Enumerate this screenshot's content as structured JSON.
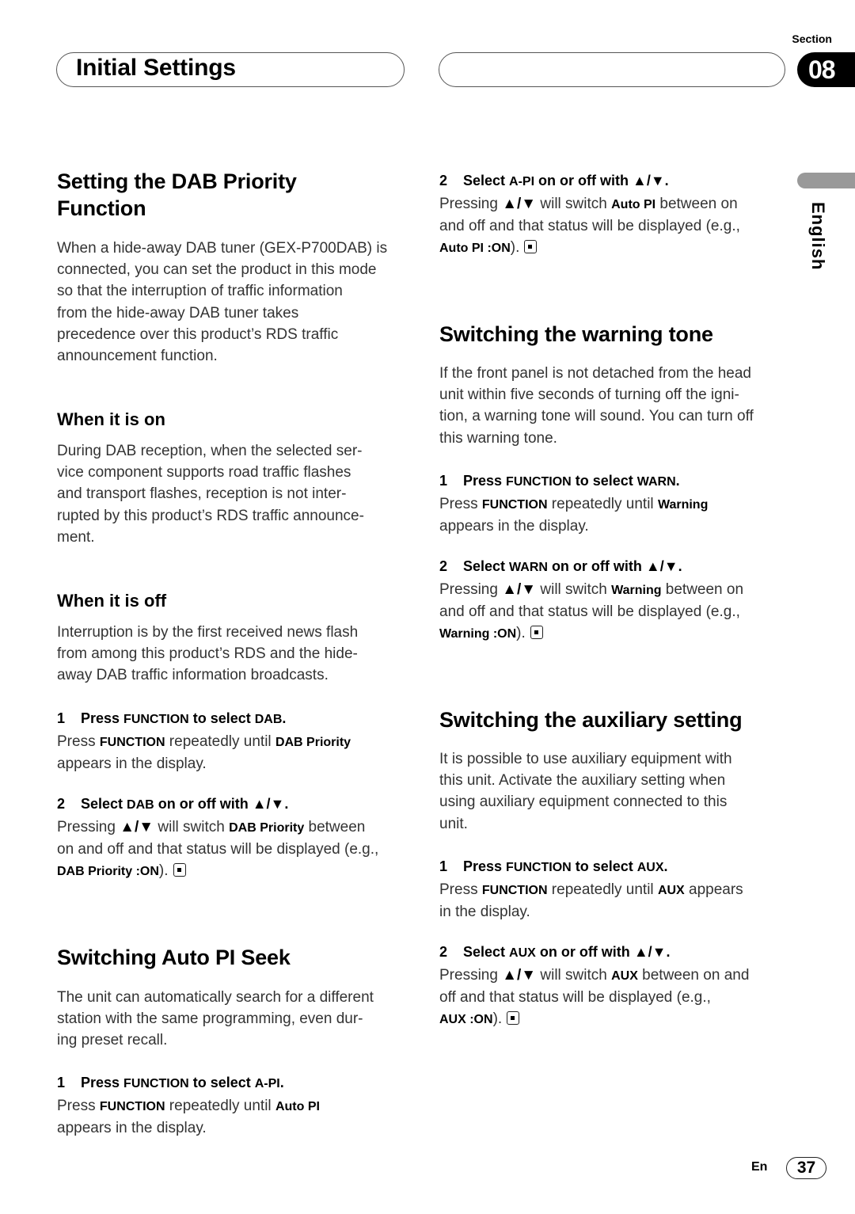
{
  "header": {
    "title": "Initial Settings",
    "section_label": "Section",
    "section_number": "08"
  },
  "sidebar": {
    "language": "English"
  },
  "icons": {
    "up_down": "▲/▼",
    "end_mark": "end-of-section-icon"
  },
  "left": {
    "dab": {
      "title_line1": "Setting the DAB Priority",
      "title_line2": "Function",
      "intro": [
        "When a hide-away DAB tuner (GEX-P700DAB) is",
        "connected, you can set the product in this mode",
        "so that the interruption of traffic information",
        "from the hide-away DAB tuner takes",
        "precedence over this product’s RDS traffic",
        "announcement function."
      ],
      "on": {
        "title": "When it is on",
        "lines": [
          "During DAB reception, when the selected ser-",
          "vice component supports road traffic flashes",
          "and transport flashes, reception is not inter-",
          "rupted by this product’s RDS traffic announce-",
          "ment."
        ]
      },
      "off": {
        "title": "When it is off",
        "lines": [
          "Interruption is by the first received news flash",
          "from among this product’s RDS and the hide-",
          "away DAB traffic information broadcasts."
        ]
      },
      "step1": {
        "num": "1",
        "pre": "Press ",
        "key": "FUNCTION",
        "mid": " to select ",
        "target": "DAB",
        "end": ".",
        "body_pre": "Press ",
        "body_key": "FUNCTION",
        "body_mid": " repeatedly until ",
        "body_target": "DAB Priority",
        "body_line2": "appears in the display."
      },
      "step2": {
        "num": "2",
        "pre": "Select ",
        "target": "DAB",
        "mid": " on or off with ",
        "end": ".",
        "body_pre": "Pressing ",
        "body_mid": " will switch ",
        "body_target": "DAB Priority",
        "body_post": " between",
        "body_line2": "on and off and that status will be displayed (e.g.,",
        "body_example": "DAB Priority :ON",
        "body_close": ")."
      }
    },
    "api": {
      "title": "Switching Auto PI Seek",
      "intro": [
        "The unit can automatically search for a different",
        "station with the same programming, even dur-",
        "ing preset recall."
      ],
      "step1": {
        "num": "1",
        "pre": "Press ",
        "key": "FUNCTION",
        "mid": " to select ",
        "target": "A-PI",
        "end": ".",
        "body_pre": "Press ",
        "body_key": "FUNCTION",
        "body_mid": " repeatedly until ",
        "body_target": "Auto PI",
        "body_line2": "appears in the display."
      }
    }
  },
  "right": {
    "api_step2": {
      "num": "2",
      "pre": "Select ",
      "target": "A-PI",
      "mid": " on or off with ",
      "end": ".",
      "body_pre": "Pressing ",
      "body_mid": " will switch ",
      "body_target": "Auto PI",
      "body_post": " between on",
      "body_line2": "and off and that status will be displayed (e.g.,",
      "body_example": "Auto PI :ON",
      "body_close": ")."
    },
    "warn": {
      "title": "Switching the warning tone",
      "intro": [
        "If the front panel is not detached from the head",
        "unit within five seconds of turning off the igni-",
        "tion, a warning tone will sound. You can turn off",
        "this warning tone."
      ],
      "step1": {
        "num": "1",
        "pre": "Press ",
        "key": "FUNCTION",
        "mid": " to select ",
        "target": "WARN",
        "end": ".",
        "body_pre": "Press ",
        "body_key": "FUNCTION",
        "body_mid": " repeatedly until ",
        "body_target": "Warning",
        "body_line2": "appears in the display."
      },
      "step2": {
        "num": "2",
        "pre": "Select ",
        "target": "WARN",
        "mid": " on or off with ",
        "end": ".",
        "body_pre": "Pressing ",
        "body_mid": " will switch ",
        "body_target": "Warning",
        "body_post": " between on",
        "body_line2": "and off and that status will be displayed (e.g.,",
        "body_example": "Warning :ON",
        "body_close": ")."
      }
    },
    "aux": {
      "title": "Switching the auxiliary setting",
      "intro": [
        "It is possible to use auxiliary equipment with",
        "this unit. Activate the auxiliary setting when",
        "using auxiliary equipment connected to this",
        "unit."
      ],
      "step1": {
        "num": "1",
        "pre": "Press ",
        "key": "FUNCTION",
        "mid": " to select ",
        "target": "AUX",
        "end": ".",
        "body_pre": "Press ",
        "body_key": "FUNCTION",
        "body_mid": " repeatedly until ",
        "body_target": "AUX",
        "body_post": " appears",
        "body_line2": "in the display."
      },
      "step2": {
        "num": "2",
        "pre": "Select ",
        "target": "AUX",
        "mid": " on or off with ",
        "end": ".",
        "body_pre": "Pressing ",
        "body_mid": " will switch ",
        "body_target": "AUX",
        "body_post": " between on and",
        "body_line2": "off and that status will be displayed (e.g.,",
        "body_example": "AUX :ON",
        "body_close": ")."
      }
    }
  },
  "footer": {
    "lang_code": "En",
    "page_number": "37"
  }
}
